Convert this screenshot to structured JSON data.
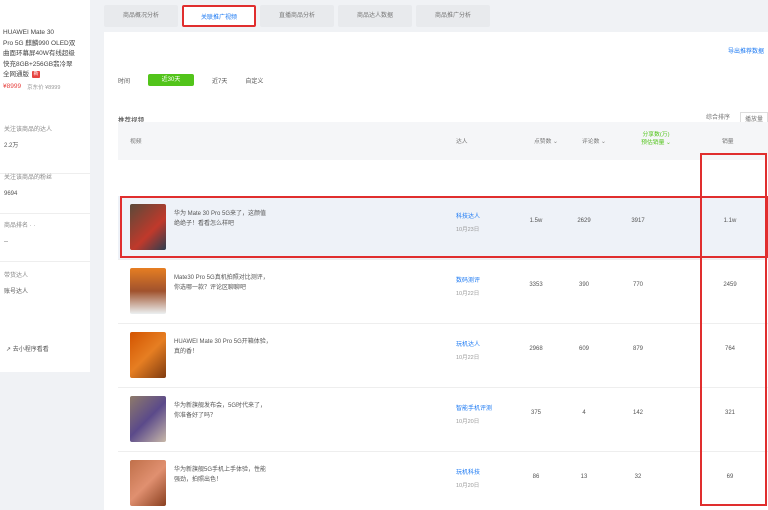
{
  "left_panel": {
    "product_title_lines": [
      "HUAWEI Mate 30",
      "Pro 5G 麒麟990 OLED双",
      "曲面环幕屏40W有线超级",
      "快充8GB+256GB翡冷翠",
      "全网通版"
    ],
    "badge": "新",
    "price": "¥8999",
    "price_sub": "京东价 ¥8999",
    "stats": [
      {
        "label": "关注该商品的达人",
        "value": "2.2万"
      },
      {
        "label": "关注该商品的粉丝",
        "value": "9694"
      },
      {
        "label": "商品排名 ·  ·",
        "value": "--"
      },
      {
        "label": "带货达人",
        "value": "账号达人"
      }
    ],
    "bottom_link": "↗ 去小程序看看"
  },
  "tabs": [
    "商品概况分析",
    "关联推广视频",
    "直播商品分析",
    "商品达人数据",
    "商品推广分析"
  ],
  "main": {
    "export_link": "导出推荐数据",
    "filter_label": "时间",
    "filters": [
      "近30天",
      "近7天",
      "自定义"
    ],
    "section_title": "推荐视频",
    "sort_label": "综合排序",
    "sort_value": "播放量",
    "table_headers": {
      "video": "视频",
      "author": "达人",
      "plays": "点赞数 ⌄",
      "comments": "评论数 ⌄",
      "shares_line1": "分享数(万)",
      "shares_line2": "预估销量 ⌄",
      "sales": "销量"
    },
    "rows": [
      {
        "desc": "华为 Mate 30 Pro 5G来了，这颜值",
        "desc2": "绝绝子！看看怎么样吧",
        "author": "科技达人",
        "date": "10月23日",
        "plays": "1.5w",
        "comments": "2629",
        "shares": "3917",
        "sales": "1.1w"
      },
      {
        "desc": "Mate30 Pro 5G真机拍照对比测评，",
        "desc2": "你选哪一款？评论区聊聊吧",
        "author": "数码测评",
        "date": "10月22日",
        "plays": "3353",
        "comments": "390",
        "shares": "770",
        "sales": "2459"
      },
      {
        "desc": "HUAWEI Mate 30 Pro 5G开箱体验，",
        "desc2": "真的香！",
        "author": "玩机达人",
        "date": "10月22日",
        "plays": "2968",
        "comments": "609",
        "shares": "879",
        "sales": "764"
      },
      {
        "desc": "华为新旗舰发布会，5G时代来了，",
        "desc2": "你准备好了吗？",
        "author": "智能手机评测",
        "date": "10月20日",
        "plays": "375",
        "comments": "4",
        "shares": "142",
        "sales": "321"
      },
      {
        "desc": "华为新旗舰5G手机上手体验，性能",
        "desc2": "强劲，拍照出色！",
        "author": "玩机科技",
        "date": "10月20日",
        "plays": "86",
        "comments": "13",
        "shares": "32",
        "sales": "69"
      }
    ]
  },
  "colors": {
    "accent_blue": "#1d7af3",
    "green": "#52c41a",
    "highlight_red": "#e02e2e",
    "price_red": "#e64340"
  }
}
